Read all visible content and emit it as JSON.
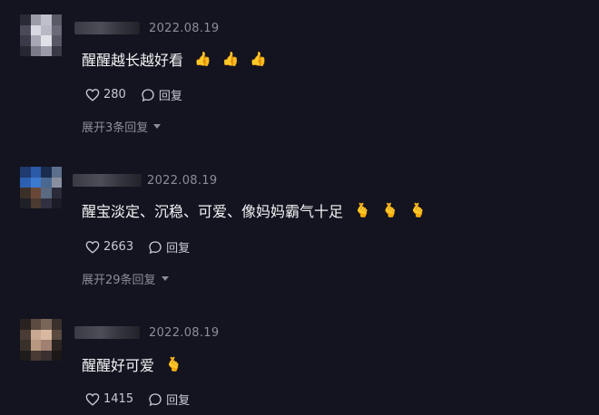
{
  "comments": [
    {
      "date": "2022.08.19",
      "text": "醒醒越长越好看",
      "emojis": [
        "👍",
        "👍",
        "👍"
      ],
      "likes": "280",
      "reply_label": "回复",
      "expand_label": "展开3条回复",
      "avatar_colors": [
        "#2a2a35",
        "#9c9ca8",
        "#c0c0cc",
        "#5a5a66",
        "#4a4a58",
        "#d8d8e0",
        "#b8b8c4",
        "#6a6a78",
        "#3a3a48",
        "#a8a8b4",
        "#e0e0e8",
        "#585866",
        "#262630",
        "#7a7a88",
        "#9a9aa8",
        "#3a3a46"
      ]
    },
    {
      "date": "2022.08.19",
      "text": "醒宝淡定、沉稳、可爱、像妈妈霸气十足",
      "emojis": [
        "🫰",
        "🫰",
        "🫰"
      ],
      "likes": "2663",
      "reply_label": "回复",
      "expand_label": "展开29条回复",
      "avatar_colors": [
        "#1e3a6e",
        "#2b5aa8",
        "#1a2c4e",
        "#5c6f8c",
        "#2d5fb0",
        "#3c7ad0",
        "#4a6890",
        "#8a8fa0",
        "#3a3028",
        "#6a4838",
        "#5a6a80",
        "#2a2a38",
        "#202028",
        "#4a3a30",
        "#303040",
        "#1c1c26"
      ]
    },
    {
      "date": "2022.08.19",
      "text": "醒醒好可爱",
      "emojis": [
        "🫰"
      ],
      "likes": "1415",
      "reply_label": "回复",
      "expand_label": "",
      "avatar_colors": [
        "#2a2220",
        "#5a4a40",
        "#7a6658",
        "#3a302c",
        "#4a3c34",
        "#c8a890",
        "#d8b8a0",
        "#5a4a40",
        "#3a302a",
        "#b89880",
        "#a08070",
        "#2a2422",
        "#201c1c",
        "#4a3c34",
        "#3a3030",
        "#1c1818"
      ]
    }
  ]
}
